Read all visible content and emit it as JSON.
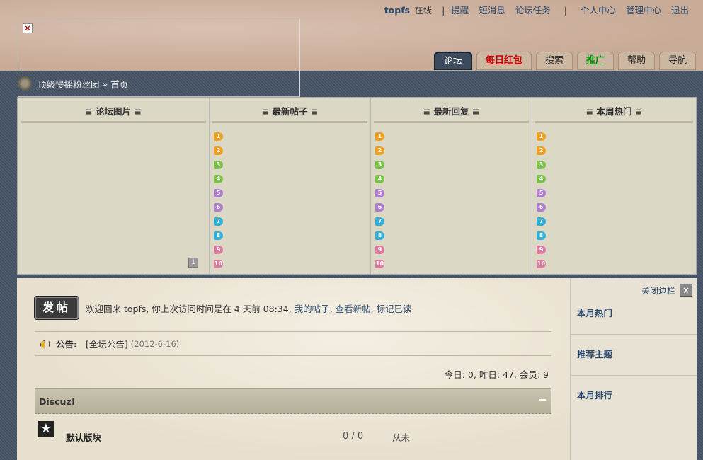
{
  "userbar": {
    "username": "topfs",
    "online": "在线",
    "sep1": "|",
    "links": [
      "提醒",
      "短消息",
      "论坛任务"
    ],
    "sep2": "|",
    "links2": [
      "个人中心",
      "管理中心",
      "退出"
    ]
  },
  "banner": {
    "broken_icon": "×"
  },
  "nav": [
    {
      "label": "论坛"
    },
    {
      "label": "每日红包"
    },
    {
      "label": "搜索"
    },
    {
      "label": "推广"
    },
    {
      "label": "帮助"
    },
    {
      "label": "导航"
    }
  ],
  "breadcrumb": {
    "site": "顶级慢摇粉丝团",
    "separator": "»",
    "current": "首页"
  },
  "feed": {
    "columns": [
      "≡ 论坛图片 ≡",
      "≡ 最新帖子 ≡",
      "≡ 最新回复 ≡",
      "≡ 本周热门 ≡"
    ],
    "rank_numbers": [
      "1",
      "2",
      "3",
      "4",
      "5",
      "6",
      "7",
      "8",
      "9",
      "10"
    ],
    "rank_colors": [
      "#f0a020",
      "#f0a020",
      "#7cc24a",
      "#7cc24a",
      "#b07ed0",
      "#b07ed0",
      "#2fb0d8",
      "#2fb0d8",
      "#e07aa0",
      "#e07aa0"
    ],
    "pager_label": "1"
  },
  "main": {
    "post_button": "发帖",
    "welcome_prefix": "欢迎回来 topfs, 你上次访问时间是在 4 天前 08:34,",
    "my_posts": "我的帖子",
    "comma1": ",",
    "new_posts": "查看新帖",
    "comma2": ",",
    "mark_read": "标记已读",
    "notice_label": "公告:",
    "notice_text": "[全坛公告]",
    "notice_date": "(2012-6-16)",
    "stats": "今日: 0, 昨日: 47, 会员: 9",
    "category": "Discuz!",
    "forum_name": "默认版块",
    "forum_count": "0 / 0",
    "forum_last": "从未"
  },
  "sidebar": {
    "close_label": "关闭边栏",
    "close_icon": "×",
    "items": [
      "本月热门",
      "推荐主题",
      "本月排行"
    ]
  }
}
